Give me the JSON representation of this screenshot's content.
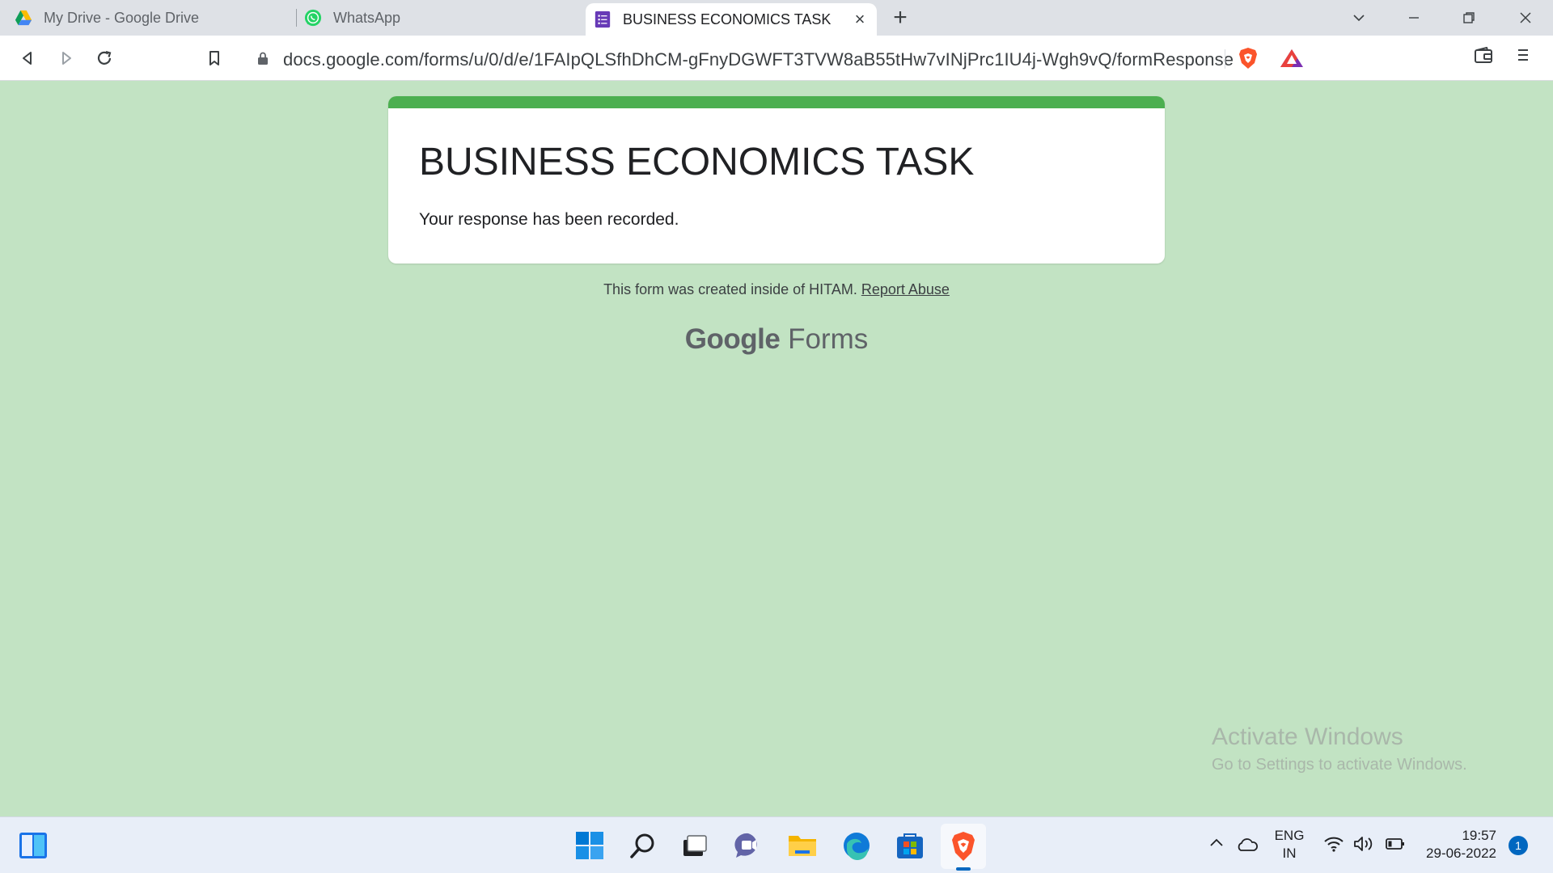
{
  "browser": {
    "tabs": [
      {
        "title": "My Drive - Google Drive",
        "icon": "google-drive-icon",
        "active": false
      },
      {
        "title": "WhatsApp",
        "icon": "whatsapp-icon",
        "active": false
      },
      {
        "title": "BUSINESS ECONOMICS TASK",
        "icon": "google-forms-icon",
        "active": true
      }
    ],
    "new_tab_label": "+",
    "close_tab_label": "×",
    "address": "docs.google.com/forms/u/0/d/e/1FAIpQLSfhDhCM-gFnyDGWFT3TVW8aB55tHw7vINjPrc1IU4j-Wgh9vQ/formResponse"
  },
  "form": {
    "title": "BUSINESS ECONOMICS TASK",
    "message": "Your response has been recorded.",
    "footer_text": "This form was created inside of HITAM.",
    "report_link": "Report Abuse",
    "brand_google": "Google",
    "brand_forms": "Forms",
    "accent_color": "#4caf50",
    "background_color": "#c2e3c3"
  },
  "watermark": {
    "line1": "Activate Windows",
    "line2": "Go to Settings to activate Windows."
  },
  "taskbar": {
    "apps": [
      "widgets-icon",
      "start-icon",
      "search-icon",
      "task-view-icon",
      "teams-chat-icon",
      "file-explorer-icon",
      "edge-icon",
      "store-icon",
      "brave-icon"
    ],
    "lang_line1": "ENG",
    "lang_line2": "IN",
    "time": "19:57",
    "date": "29-06-2022",
    "notifications": "1"
  }
}
